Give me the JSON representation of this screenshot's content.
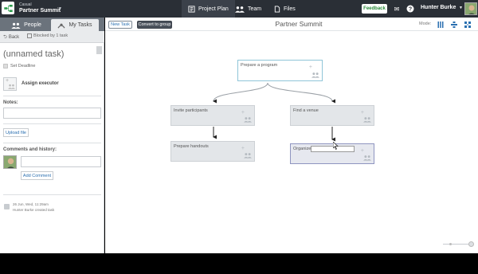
{
  "topbar": {
    "project_subtitle": "Casual",
    "project_name": "Partner Summit",
    "nav": [
      {
        "label": "Project Plan",
        "icon": "project-plan-icon"
      },
      {
        "label": "Team",
        "icon": "team-icon"
      },
      {
        "label": "Files",
        "icon": "files-icon"
      }
    ],
    "feedback_label": "Feedback",
    "user_name": "Hunter Burke"
  },
  "left_panel": {
    "tabs": [
      {
        "label": "People",
        "icon": "people-icon"
      },
      {
        "label": "My Tasks",
        "icon": "tasks-icon"
      }
    ],
    "back_label": "Back",
    "blocked_label": "Blocked by 1 task",
    "task_title": "(unnamed task)",
    "set_deadline_label": "Set Deadline",
    "assign_executor_label": "Assign executor",
    "notes_label": "Notes:",
    "upload_label": "Upload file",
    "comments_label": "Comments and history:",
    "add_comment_label": "Add Comment",
    "history": [
      {
        "date": "26 Jun, Wed, 11:29am",
        "text": "Hunter Burke created task"
      }
    ]
  },
  "canvas": {
    "new_task_label": "New Task",
    "convert_label": "Convert to group",
    "title": "Partner Summit",
    "mode_label": "Mode:",
    "cards": [
      {
        "label": "Prepare a program"
      },
      {
        "label": "Invite participants"
      },
      {
        "label": "Find a venue"
      },
      {
        "label": "Prepare handouts"
      },
      {
        "label": "Organize"
      }
    ]
  },
  "colors": {
    "topbar_bg": "#2a2f36",
    "accent_link": "#2a6fb0",
    "feedback_green": "#2a8a3a",
    "selected_border": "#8fc5d8"
  }
}
